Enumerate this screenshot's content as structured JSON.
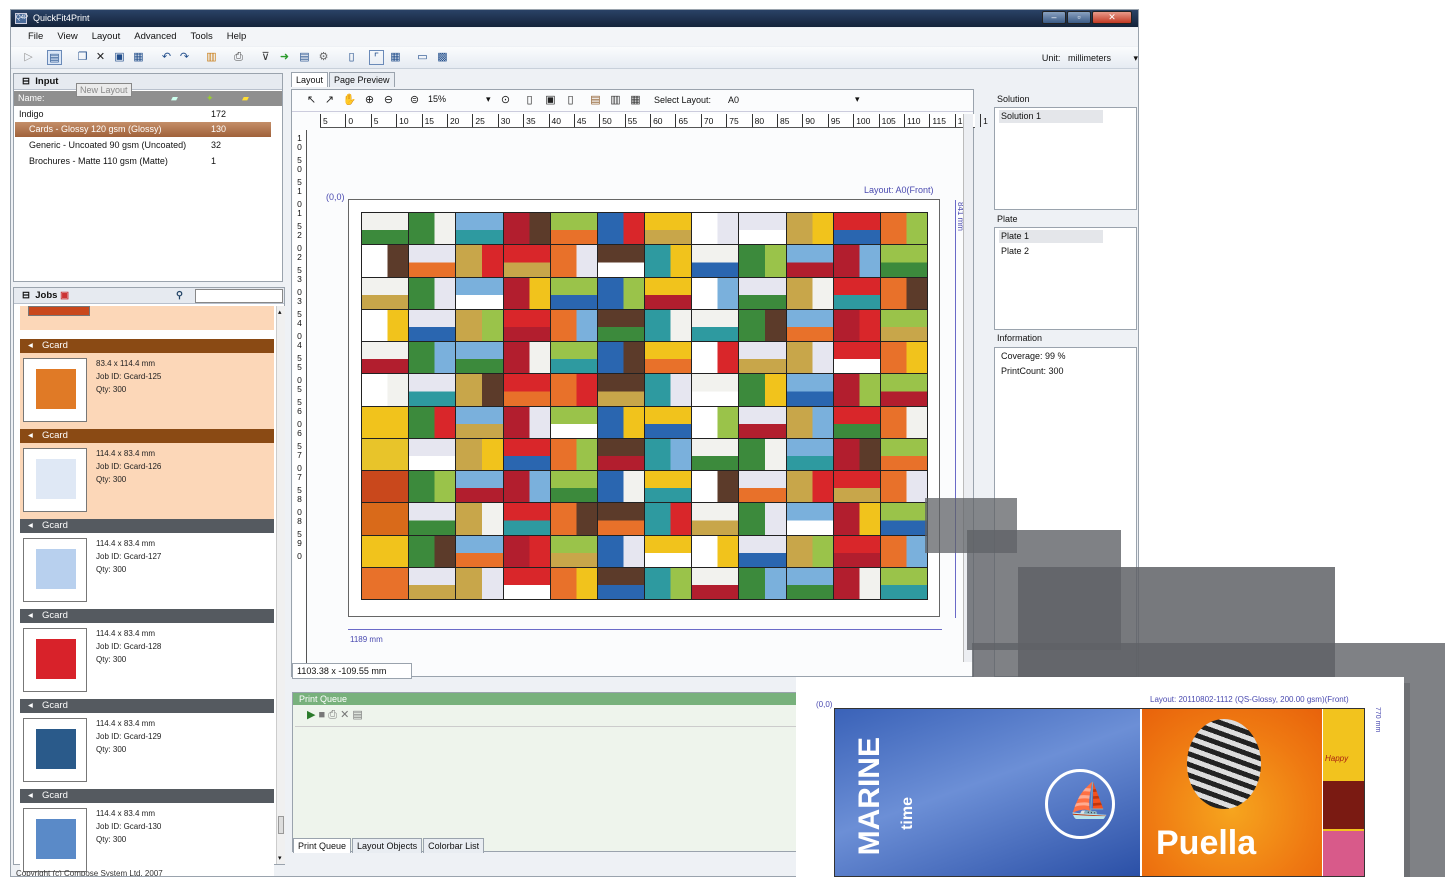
{
  "window": {
    "title": "QuickFit4Print",
    "icon_label": "Q4P"
  },
  "menu": [
    "File",
    "View",
    "Layout",
    "Advanced",
    "Tools",
    "Help"
  ],
  "toolbar": {
    "tooltip": "New Layout",
    "unit_label": "Unit:",
    "unit_value": "millimeters"
  },
  "input": {
    "title": "Input",
    "name_header": "Name:",
    "rows": [
      {
        "name": "Indigo",
        "count": "172"
      },
      {
        "name": "Cards - Glossy 120 gsm (Glossy)",
        "count": "130"
      },
      {
        "name": "Generic - Uncoated 90 gsm (Uncoated)",
        "count": "32"
      },
      {
        "name": "Brochures - Matte 110 gsm (Matte)",
        "count": "1"
      }
    ]
  },
  "jobs": {
    "title": "Jobs",
    "items": [
      {
        "name": "Gcard",
        "size": "83.4 x 114.4 mm",
        "job_id": "Job ID: Gcard-125",
        "qty": "Qty: 300"
      },
      {
        "name": "Gcard",
        "size": "114.4 x 83.4 mm",
        "job_id": "Job ID: Gcard-126",
        "qty": "Qty: 300"
      },
      {
        "name": "Gcard",
        "size": "114.4 x 83.4 mm",
        "job_id": "Job ID: Gcard-127",
        "qty": "Qty: 300"
      },
      {
        "name": "Gcard",
        "size": "114.4 x 83.4 mm",
        "job_id": "Job ID: Gcard-128",
        "qty": "Qty: 300"
      },
      {
        "name": "Gcard",
        "size": "114.4 x 83.4 mm",
        "job_id": "Job ID: Gcard-129",
        "qty": "Qty: 300"
      },
      {
        "name": "Gcard",
        "size": "114.4 x 83.4 mm",
        "job_id": "Job ID: Gcard-130",
        "qty": "Qty: 300"
      }
    ]
  },
  "layout": {
    "tabs": [
      "Layout",
      "Page Preview"
    ],
    "zoom": "15%",
    "select_layout_label": "Select Layout:",
    "select_layout_value": "A0",
    "ruler_h": [
      "5",
      "0",
      "5",
      "10",
      "15",
      "20",
      "25",
      "30",
      "35",
      "40",
      "45",
      "50",
      "55",
      "60",
      "65",
      "70",
      "75",
      "80",
      "85",
      "90",
      "95",
      "100",
      "105",
      "110",
      "115",
      "120",
      "1"
    ],
    "ruler_v": [
      "1",
      "0",
      "5",
      "0",
      "5",
      "1",
      "0",
      "1",
      "5",
      "2",
      "0",
      "2",
      "5",
      "3",
      "0",
      "3",
      "5",
      "4",
      "0",
      "4",
      "5",
      "5",
      "0",
      "5",
      "5",
      "6",
      "0",
      "6",
      "5",
      "7",
      "0",
      "7",
      "5",
      "8",
      "0",
      "8",
      "5",
      "9",
      "0"
    ],
    "origin": "(0,0)",
    "sheet_label": "Layout: A0(Front)",
    "width_label": "1189 mm",
    "height_label": "841 mm",
    "cursor_pos": "1103.38 x -109.55 mm"
  },
  "print_queue": {
    "title": "Print Queue",
    "tabs": [
      "Print Queue",
      "Layout Objects",
      "Colorbar List"
    ]
  },
  "right": {
    "solution_label": "Solution",
    "solutions": [
      "Solution 1"
    ],
    "plate_label": "Plate",
    "plates": [
      "Plate 1",
      "Plate 2"
    ],
    "info_label": "Information",
    "coverage": "Coverage: 99 %",
    "printcount": "PrintCount: 300"
  },
  "footer": {
    "copyright": "Copyright (c) Compose System Ltd. 2007"
  },
  "preview": {
    "origin": "(0,0)",
    "label": "Layout: 20110802-1112 (QS-Glossy, 200.00 gsm)(Front)",
    "height_label": "770 mm",
    "text_marine": "MARINE",
    "text_time": "time",
    "text_puella": "Puella",
    "text_happy": "Happy"
  },
  "colors": {
    "title": "#1b2d48",
    "accent_job": "#8a4a14",
    "job_selected_bg": "#fcd7b8",
    "queue_green": "#78b17c"
  }
}
